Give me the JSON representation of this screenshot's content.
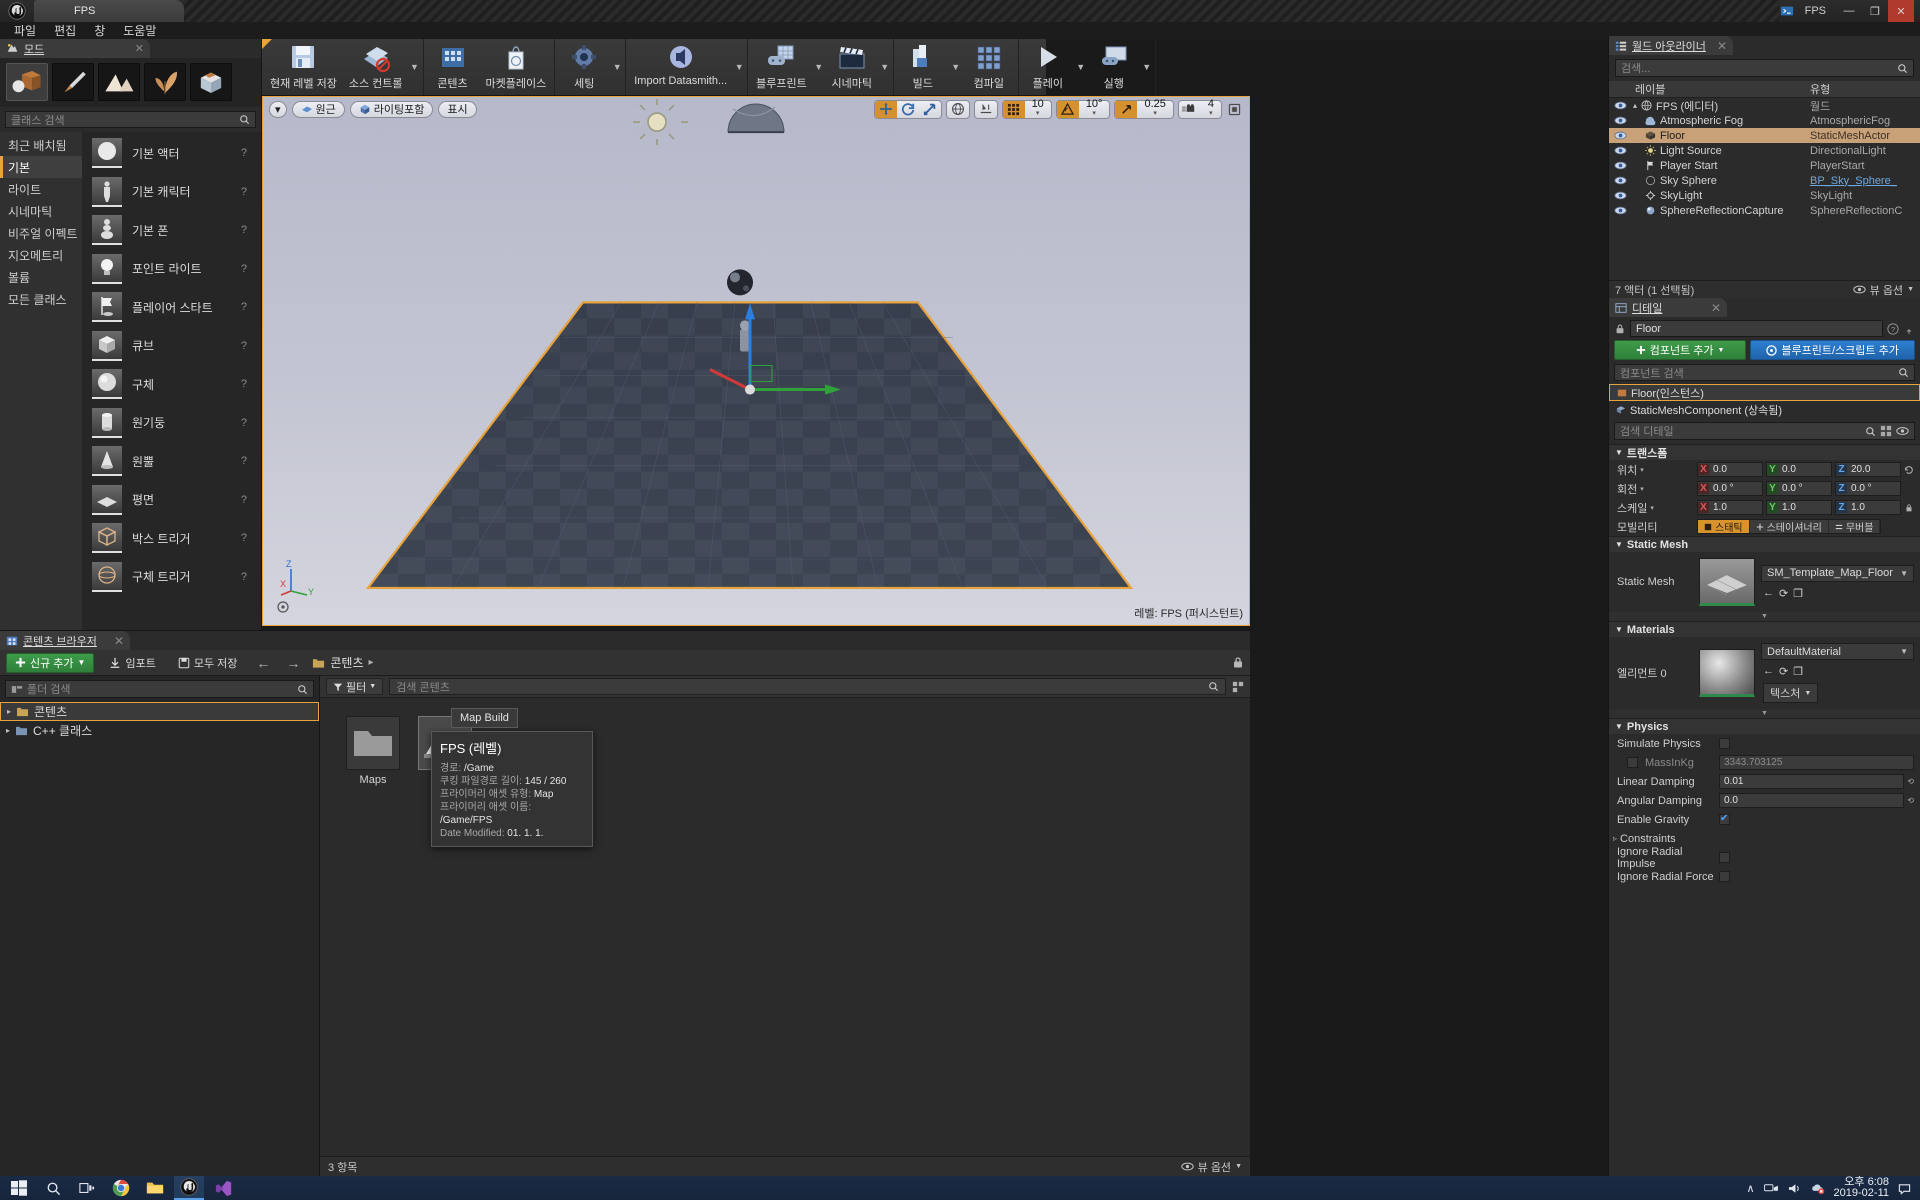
{
  "window": {
    "app_icon": "unreal-logo-icon",
    "document_tab": "FPS",
    "project_name": "FPS",
    "minimize": "—",
    "maximize": "❐",
    "close": "✕"
  },
  "menubar": {
    "items": [
      "파일",
      "편집",
      "창",
      "도움말"
    ]
  },
  "modes_panel": {
    "tab_label": "모드",
    "close_icon": "✕",
    "mode_buttons": [
      {
        "name": "place-mode",
        "icon": "place-actors-icon",
        "active": true
      },
      {
        "name": "paint-mode",
        "icon": "paint-brush-icon",
        "active": false
      },
      {
        "name": "landscape-mode",
        "icon": "landscape-icon",
        "active": false
      },
      {
        "name": "foliage-mode",
        "icon": "foliage-leaf-icon",
        "active": false
      },
      {
        "name": "geometry-edit-mode",
        "icon": "geometry-box-icon",
        "active": false
      }
    ],
    "search_placeholder": "클래스 검색",
    "categories": [
      {
        "label": "최근 배치됨",
        "selected": false
      },
      {
        "label": "기본",
        "selected": true
      },
      {
        "label": "라이트",
        "selected": false
      },
      {
        "label": "시네마틱",
        "selected": false
      },
      {
        "label": "비주얼 이펙트",
        "selected": false
      },
      {
        "label": "지오메트리",
        "selected": false
      },
      {
        "label": "볼륨",
        "selected": false
      },
      {
        "label": "모든 클래스",
        "selected": false
      }
    ],
    "assets": [
      {
        "label": "기본 액터",
        "icon": "sphere-actor-icon",
        "help": "?"
      },
      {
        "label": "기본 캐릭터",
        "icon": "character-icon",
        "help": "?"
      },
      {
        "label": "기본 폰",
        "icon": "pawn-icon",
        "help": "?"
      },
      {
        "label": "포인트 라이트",
        "icon": "point-light-icon",
        "help": "?"
      },
      {
        "label": "플레이어 스타트",
        "icon": "player-start-icon",
        "help": "?"
      },
      {
        "label": "큐브",
        "icon": "cube-icon",
        "help": "?"
      },
      {
        "label": "구체",
        "icon": "sphere-icon",
        "help": "?"
      },
      {
        "label": "원기둥",
        "icon": "cylinder-icon",
        "help": "?"
      },
      {
        "label": "원뿔",
        "icon": "cone-icon",
        "help": "?"
      },
      {
        "label": "평면",
        "icon": "plane-icon",
        "help": "?"
      },
      {
        "label": "박스 트리거",
        "icon": "box-trigger-icon",
        "help": "?"
      },
      {
        "label": "구체 트리거",
        "icon": "sphere-trigger-icon",
        "help": "?"
      }
    ]
  },
  "main_toolbar": {
    "items": [
      {
        "label": "현재 레벨 저장",
        "icon": "save-icon",
        "caret": false
      },
      {
        "label": "소스 컨트롤",
        "icon": "source-control-disabled-icon",
        "caret": true
      },
      {
        "label": "콘텐츠",
        "icon": "content-icon",
        "caret": false
      },
      {
        "label": "마켓플레이스",
        "icon": "marketplace-bag-icon",
        "caret": false
      },
      {
        "label": "세팅",
        "icon": "settings-gear-icon",
        "caret": true
      },
      {
        "label": "Import Datasmith...",
        "icon": "datasmith-icon",
        "caret": true
      },
      {
        "label": "블루프린트",
        "icon": "blueprint-icon",
        "caret": true
      },
      {
        "label": "시네마틱",
        "icon": "cinematic-clapper-icon",
        "caret": true
      },
      {
        "label": "빌드",
        "icon": "build-icon",
        "caret": true
      },
      {
        "label": "컴파일",
        "icon": "compile-icon",
        "caret": false
      },
      {
        "label": "플레이",
        "icon": "play-icon",
        "caret": true
      },
      {
        "label": "실행",
        "icon": "launch-icon",
        "caret": true
      }
    ]
  },
  "viewport": {
    "menu_caret": "▾",
    "view_mode_perspective": "원근",
    "view_mode_lit": "라이팅포함",
    "show_label": "표시",
    "transform_tools": [
      {
        "name": "translate",
        "icon": "move-gizmo-icon",
        "active": true
      },
      {
        "name": "rotate",
        "icon": "rotate-gizmo-icon",
        "active": false
      },
      {
        "name": "scale",
        "icon": "scale-gizmo-icon",
        "active": false
      }
    ],
    "coordinate_system_icon": "world-globe-icon",
    "surface_snap_icon": "surface-snap-icon",
    "grid_snap": {
      "icon": "grid-icon",
      "value": "10",
      "enabled": true
    },
    "rotation_snap": {
      "icon": "angle-icon",
      "value": "10°",
      "enabled": true
    },
    "scale_snap": {
      "icon": "scale-arrow-icon",
      "value": "0.25",
      "enabled": true
    },
    "camera_speed": {
      "icon": "camera-speed-icon",
      "value": "4",
      "enabled": false
    },
    "maximize_icon": "maximize-viewport-icon",
    "level_label": "레벨: FPS (퍼시스턴트)",
    "axis_labels": {
      "z": "Z",
      "x": "X",
      "y": "Y"
    }
  },
  "content_browser": {
    "tab_label": "콘텐츠 브라우저",
    "close_icon": "✕",
    "new_add_label": "신규 추가",
    "import_label": "임포트",
    "save_all_label": "모두 저장",
    "back_icon": "←",
    "forward_icon": "→",
    "breadcrumb": "콘텐츠",
    "breadcrumb_caret": "▸",
    "lock_icon": "lock-icon",
    "folder_search_placeholder": "폴더 검색",
    "tree": [
      {
        "label": "콘텐츠",
        "selected": true,
        "icon": "folder-icon",
        "expander": "▸"
      },
      {
        "label": "C++ 클래스",
        "selected": false,
        "icon": "cpp-folder-icon",
        "expander": "▸"
      }
    ],
    "filter_label": "필터",
    "search_placeholder": "검색 콘텐츠",
    "items": [
      {
        "label": "Maps",
        "type": "folder",
        "selected": false
      },
      {
        "label": "FPS",
        "type": "level",
        "selected": true
      }
    ],
    "status_count": "3 항목",
    "view_options": "뷰 옵션",
    "tooltip": {
      "chip_label": "Map Build",
      "title": "FPS (레벨)",
      "rows": [
        {
          "key": "경로:",
          "val": "/Game"
        },
        {
          "key": "쿠킹 파일경로 길이:",
          "val": "145 / 260"
        },
        {
          "key": "프라이머리 애셋 유형:",
          "val": "Map"
        },
        {
          "key": "프라이머리 애셋 이름:",
          "val": "/Game/FPS"
        },
        {
          "key": "Date Modified:",
          "val": "01. 1. 1."
        }
      ]
    }
  },
  "world_outliner": {
    "tab_label": "월드 아웃라이너",
    "close_icon": "✕",
    "search_placeholder": "검색...",
    "columns": {
      "label": "레이블",
      "type": "유형"
    },
    "rows": [
      {
        "label": "FPS (에디터)",
        "type": "월드",
        "selected": false,
        "depth": 0,
        "icon": "world-icon",
        "expander": "▴"
      },
      {
        "label": "Atmospheric Fog",
        "type": "AtmosphericFog",
        "selected": false,
        "depth": 1,
        "icon": "fog-icon"
      },
      {
        "label": "Floor",
        "type": "StaticMeshActor",
        "selected": true,
        "depth": 1,
        "icon": "mesh-icon"
      },
      {
        "label": "Light Source",
        "type": "DirectionalLight",
        "selected": false,
        "depth": 1,
        "icon": "light-icon"
      },
      {
        "label": "Player Start",
        "type": "PlayerStart",
        "selected": false,
        "depth": 1,
        "icon": "player-start-icon"
      },
      {
        "label": "Sky Sphere",
        "type": "BP_Sky_Sphere_",
        "selected": false,
        "depth": 1,
        "icon": "sphere-icon",
        "type_is_link": true
      },
      {
        "label": "SkyLight",
        "type": "SkyLight",
        "selected": false,
        "depth": 1,
        "icon": "skylight-icon"
      },
      {
        "label": "SphereReflectionCapture",
        "type": "SphereReflectionC",
        "selected": false,
        "depth": 1,
        "icon": "reflection-icon"
      }
    ],
    "status": "7 액터 (1 선택됨)",
    "view_options": "뷰 옵션"
  },
  "details": {
    "tab_label": "디테일",
    "close_icon": "✕",
    "actor_name": "Floor",
    "add_component_label": "컴포넌트 추가",
    "add_blueprint_label": "블루프린트/스크립트 추가",
    "component_search_placeholder": "컴포넌트 검색",
    "components": [
      {
        "label": "Floor(인스턴스)",
        "highlight": true,
        "icon": "actor-icon"
      },
      {
        "label": "StaticMeshComponent (상속됨)",
        "highlight": false,
        "icon": "mesh-component-icon"
      }
    ],
    "details_search_placeholder": "검색 디테일",
    "sections": {
      "transform": {
        "title": "트랜스폼",
        "rows": [
          {
            "label": "위치",
            "caret": "▾",
            "x": "0.0",
            "y": "0.0",
            "z": "20.0"
          },
          {
            "label": "회전",
            "caret": "▾",
            "x": "0.0 °",
            "y": "0.0 °",
            "z": "0.0 °"
          },
          {
            "label": "스케일",
            "caret": "▾",
            "x": "1.0",
            "y": "1.0",
            "z": "1.0"
          }
        ],
        "mobility_label": "모빌리티",
        "mobility_options": [
          {
            "label": "스태틱",
            "active": true,
            "icon": "static-icon"
          },
          {
            "label": "스테이셔너리",
            "active": false,
            "icon": "stationary-icon"
          },
          {
            "label": "무버블",
            "active": false,
            "icon": "movable-icon"
          }
        ]
      },
      "static_mesh": {
        "title": "Static Mesh",
        "label": "Static Mesh",
        "value": "SM_Template_Map_Floor",
        "buttons": [
          "←",
          "⟳",
          "❐"
        ]
      },
      "materials": {
        "title": "Materials",
        "label": "엘리먼트 0",
        "value": "DefaultMaterial",
        "buttons": [
          "←",
          "⟳",
          "❐"
        ],
        "texture_label": "텍스처"
      },
      "physics": {
        "title": "Physics",
        "rows": [
          {
            "label": "Simulate Physics",
            "type": "checkbox",
            "checked": false
          },
          {
            "label": "MassInKg",
            "type": "text",
            "value": "3343.703125",
            "disabled": true
          },
          {
            "label": "Linear Damping",
            "type": "text",
            "value": "0.01"
          },
          {
            "label": "Angular Damping",
            "type": "text",
            "value": "0.0"
          },
          {
            "label": "Enable Gravity",
            "type": "checkbox",
            "checked": true
          },
          {
            "label": "Constraints",
            "type": "expander",
            "expander": "▹"
          },
          {
            "label": "Ignore Radial Impulse",
            "type": "checkbox",
            "checked": false
          },
          {
            "label": "Ignore Radial Force",
            "type": "checkbox",
            "checked": false
          }
        ]
      }
    }
  },
  "taskbar": {
    "start_icon": "windows-start-icon",
    "search_icon": "search-icon",
    "taskview_icon": "task-view-icon",
    "apps": [
      {
        "name": "chrome",
        "icon": "chrome-icon",
        "active": false
      },
      {
        "name": "file-explorer",
        "icon": "folder-icon",
        "active": false
      },
      {
        "name": "unreal-editor",
        "icon": "unreal-icon",
        "active": true
      },
      {
        "name": "visual-studio",
        "icon": "visual-studio-icon",
        "active": false
      }
    ],
    "tray": {
      "chevron": "∧",
      "icons": [
        "network-icon",
        "volume-icon",
        "onedrive-error-icon"
      ],
      "time": "오후 6:08",
      "date": "2019-02-11",
      "notification_icon": "notification-icon"
    }
  }
}
